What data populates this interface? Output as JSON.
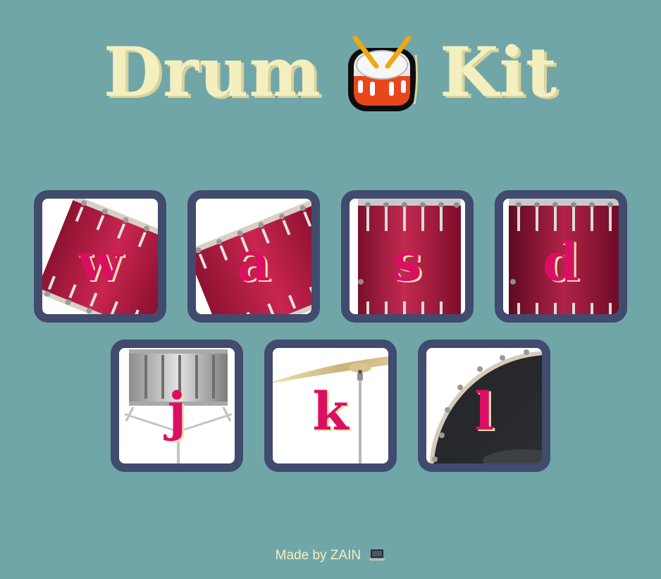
{
  "header": {
    "word_left": "Drum",
    "emoji_icon": "drum-emoji",
    "word_right": "Kit"
  },
  "drums": [
    {
      "key": "w",
      "art": "red-tom-tilted-left"
    },
    {
      "key": "a",
      "art": "red-tom-tilted-right"
    },
    {
      "key": "s",
      "art": "red-floor-tom"
    },
    {
      "key": "d",
      "art": "red-floor-tom-dark"
    },
    {
      "key": "j",
      "art": "snare-on-stand"
    },
    {
      "key": "k",
      "art": "crash-cymbal"
    },
    {
      "key": "l",
      "art": "kick-drum-head"
    }
  ],
  "footer": {
    "text": "Made by ZAIN",
    "icon": "laptop-emoji"
  },
  "colors": {
    "background": "#71a6a9",
    "title": "#f3efbf",
    "border": "#404b6d",
    "letter": "#da0f63"
  }
}
